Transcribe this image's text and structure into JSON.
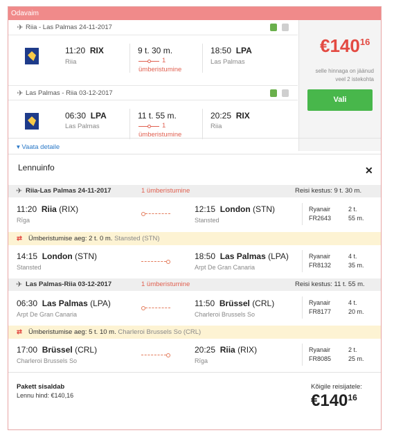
{
  "header": {
    "title": "Odavaim"
  },
  "segments": [
    {
      "title": "Riia - Las Palmas 24-11-2017",
      "dep_time": "11:20",
      "dep_code": "RIX",
      "dep_city": "Riia",
      "duration": "9 t. 30 m.",
      "stops_count": "1",
      "stops_label": "ümberistumine",
      "arr_time": "18:50",
      "arr_code": "LPA",
      "arr_city": "Las Palmas"
    },
    {
      "title": "Las Palmas - Riia 03-12-2017",
      "dep_time": "06:30",
      "dep_code": "LPA",
      "dep_city": "Las Palmas",
      "duration": "11 t. 55 m.",
      "stops_count": "1",
      "stops_label": "ümberistumine",
      "arr_time": "20:25",
      "arr_code": "RIX",
      "arr_city": "Riia"
    }
  ],
  "price": {
    "currency": "€",
    "integer": "140",
    "cents": "16",
    "note": "selle hinnaga on jäänud veel 2 istekohta",
    "button_label": "Vali",
    "accent": "#e34a42",
    "button_color": "#48b74b"
  },
  "details_link": "Vaata detaile",
  "flight_info": {
    "title": "Lennuinfo",
    "close_icon": "close-icon",
    "legs": [
      {
        "title": "Riia-Las Palmas 24-11-2017",
        "stops": "1 ümberistumine",
        "total_duration": "Reisi kestus: 9 t. 30 m.",
        "flights": [
          {
            "dep_time": "11:20",
            "dep_city": "Riia",
            "dep_code": "(RIX)",
            "dep_airport": "Rīga",
            "arr_time": "12:15",
            "arr_city": "London",
            "arr_code": "(STN)",
            "arr_airport": "Stansted",
            "airline": "Ryanair",
            "flight_no": "FR2643",
            "dur_h": "2 t.",
            "dur_m": "55 m."
          },
          {
            "dep_time": "14:15",
            "dep_city": "London",
            "dep_code": "(STN)",
            "dep_airport": "Stansted",
            "arr_time": "18:50",
            "arr_city": "Las Palmas",
            "arr_code": "(LPA)",
            "arr_airport": "Arpt De Gran Canaria",
            "airline": "Ryanair",
            "flight_no": "FR8132",
            "dur_h": "4 t.",
            "dur_m": "35 m."
          }
        ],
        "layover": {
          "label": "Ümberistumise aeg: 2 t. 0 m.",
          "location": "Stansted (STN)"
        }
      },
      {
        "title": "Las Palmas-Riia 03-12-2017",
        "stops": "1 ümberistumine",
        "total_duration": "Reisi kestus: 11 t. 55 m.",
        "flights": [
          {
            "dep_time": "06:30",
            "dep_city": "Las Palmas",
            "dep_code": "(LPA)",
            "dep_airport": "Arpt De Gran Canaria",
            "arr_time": "11:50",
            "arr_city": "Brüssel",
            "arr_code": "(CRL)",
            "arr_airport": "Charleroi Brussels So",
            "airline": "Ryanair",
            "flight_no": "FR8177",
            "dur_h": "4 t.",
            "dur_m": "20 m."
          },
          {
            "dep_time": "17:00",
            "dep_city": "Brüssel",
            "dep_code": "(CRL)",
            "dep_airport": "Charleroi Brussels So",
            "arr_time": "20:25",
            "arr_city": "Riia",
            "arr_code": "(RIX)",
            "arr_airport": "Rīga",
            "airline": "Ryanair",
            "flight_no": "FR8085",
            "dur_h": "2 t.",
            "dur_m": "25 m."
          }
        ],
        "layover": {
          "label": "Ümberistumise aeg: 5 t. 10 m.",
          "location": "Charleroi Brussels So (CRL)"
        }
      }
    ]
  },
  "package": {
    "title": "Pakett sisaldab",
    "line": "Lennu hind: €140,16",
    "total_label": "Kõigile reisijatele:",
    "total_currency": "€",
    "total_integer": "140",
    "total_cents": "16"
  }
}
